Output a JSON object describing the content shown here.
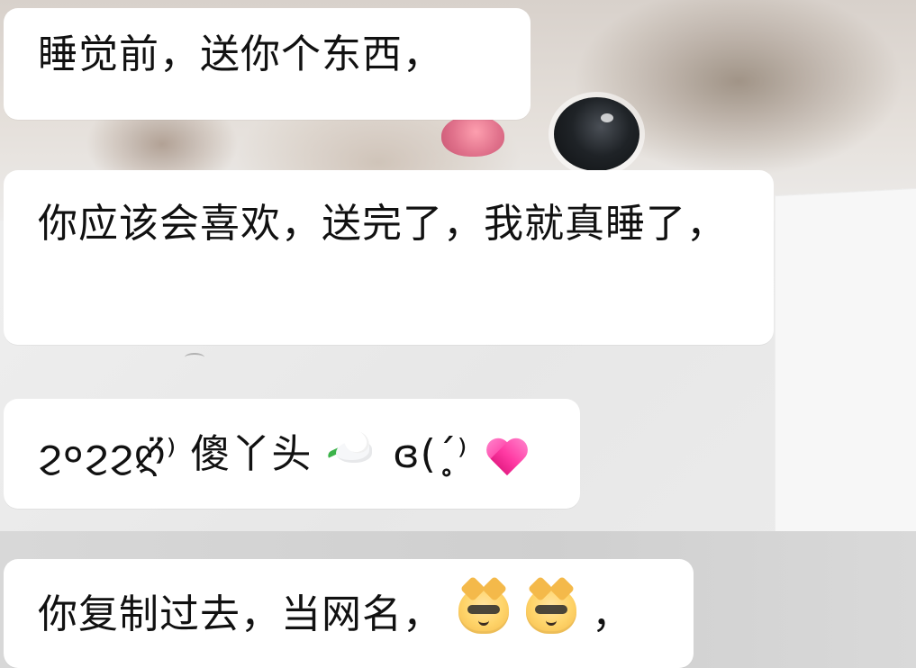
{
  "messages": [
    {
      "id": "m1",
      "text": "睡觉前，送你个东西，"
    },
    {
      "id": "m2",
      "text": "你应该会喜欢，送完了，我就真睡了，"
    },
    {
      "id": "m3",
      "text_parts": [
        "ϩ०ϩϩღ̸",
        "̈",
        "⁾ 傻丫头",
        "ɞ(ˊ̥",
        "⁾"
      ],
      "emoji_icons": [
        "dove-icon",
        "pink-hearts-icon"
      ]
    },
    {
      "id": "m4",
      "text_before_emojis": "你复制过去，当网名，",
      "text_after_emojis": "，",
      "emoji_icons": [
        "doge-sunglasses-icon",
        "doge-sunglasses-icon"
      ]
    }
  ],
  "colors": {
    "bubble_bg": "#ffffff",
    "text": "#111111",
    "accent_pink": "#ff3aa3"
  }
}
